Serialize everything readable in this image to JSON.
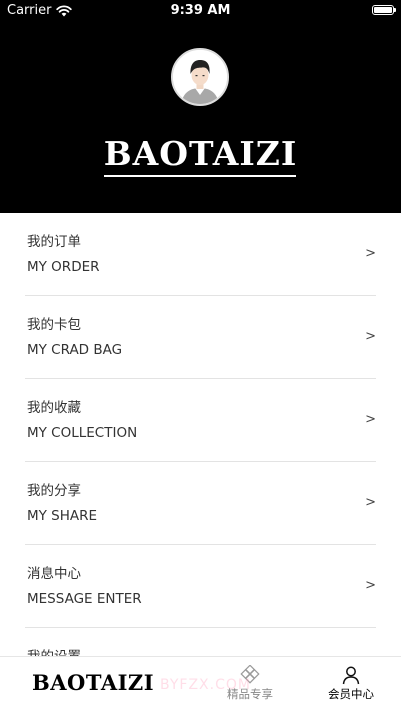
{
  "status_bar": {
    "carrier": "Carrier",
    "time": "9:39 AM"
  },
  "header": {
    "brand": "BAOTAIZI",
    "background_color": "#000000"
  },
  "menu": {
    "items": [
      {
        "zh": "我的订单",
        "en": "MY ORDER",
        "arrow": ">"
      },
      {
        "zh": "我的卡包",
        "en": "MY CRAD BAG",
        "arrow": ">"
      },
      {
        "zh": "我的收藏",
        "en": "MY COLLECTION",
        "arrow": ">"
      },
      {
        "zh": "我的分享",
        "en": "MY SHARE",
        "arrow": ">"
      },
      {
        "zh": "消息中心",
        "en": "MESSAGE ENTER",
        "arrow": ">"
      },
      {
        "zh": "我的设置",
        "en": "",
        "arrow": ""
      }
    ]
  },
  "tabbar": {
    "home_logo": "BAOTAIZI",
    "boutique_label": "精品专享",
    "member_label": "会员中心",
    "active_tab": "会员中心"
  },
  "watermark": "BYFZX.COM",
  "icons": {
    "wifi": "wifi-icon",
    "battery": "battery-icon",
    "avatar": "avatar-icon",
    "boutique": "diamond-grid-icon",
    "member": "person-icon"
  }
}
